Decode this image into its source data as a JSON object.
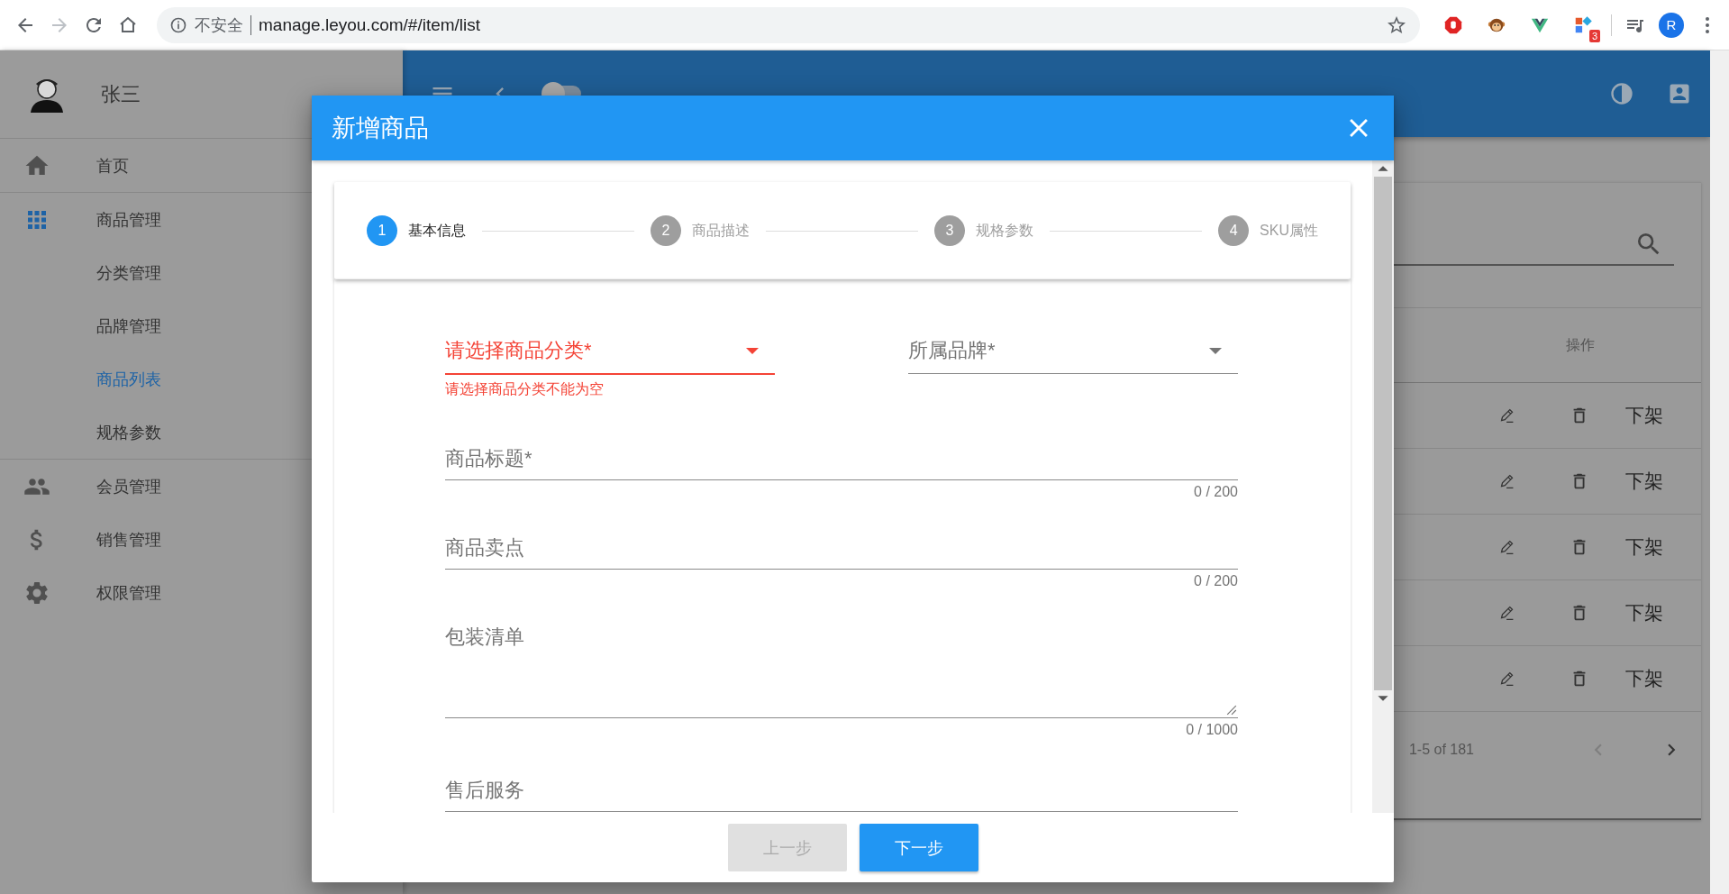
{
  "browser": {
    "security_label": "不安全",
    "url": "manage.leyou.com/#/item/list",
    "extension_badge": "3",
    "profile_initial": "R"
  },
  "sidebar": {
    "user_name": "张三",
    "items": [
      {
        "label": "首页",
        "selected": false
      },
      {
        "label": "商品管理",
        "selected": false,
        "expanded": true,
        "children": [
          {
            "label": "分类管理",
            "selected": false
          },
          {
            "label": "品牌管理",
            "selected": false
          },
          {
            "label": "商品列表",
            "selected": true
          },
          {
            "label": "规格参数",
            "selected": false
          }
        ]
      },
      {
        "label": "会员管理",
        "selected": false
      },
      {
        "label": "销售管理",
        "selected": false
      },
      {
        "label": "权限管理",
        "selected": false
      }
    ]
  },
  "header": {
    "dark_mode": false
  },
  "table": {
    "columns": [
      "操作"
    ],
    "rows": [
      {
        "action": "下架"
      },
      {
        "action": "下架"
      },
      {
        "action": "下架"
      },
      {
        "action": "下架"
      },
      {
        "action": "下架"
      }
    ],
    "pagination": {
      "range": "1-5 of 181",
      "previous_disabled": true,
      "next_disabled": false
    }
  },
  "dialog": {
    "title": "新增商品",
    "steps": [
      {
        "number": "1",
        "label": "基本信息",
        "selected": true
      },
      {
        "number": "2",
        "label": "商品描述",
        "selected": false
      },
      {
        "number": "3",
        "label": "规格参数",
        "selected": false
      },
      {
        "number": "4",
        "label": "SKU属性",
        "selected": false
      }
    ],
    "selects": [
      {
        "label": "请选择商品分类*",
        "error": "请选择商品分类不能为空"
      },
      {
        "label": "所属品牌*"
      }
    ],
    "inputs": [
      {
        "kind": "text",
        "label": "商品标题*",
        "counter": "0 / 200"
      },
      {
        "kind": "text",
        "label": "商品卖点",
        "counter": "0 / 200"
      },
      {
        "kind": "textarea",
        "label": "包装清单",
        "counter": "0 / 1000"
      },
      {
        "kind": "text",
        "label": "售后服务"
      }
    ],
    "buttons": [
      {
        "label": "上一步",
        "disabled": true
      },
      {
        "label": "下一步",
        "disabled": false
      }
    ]
  }
}
